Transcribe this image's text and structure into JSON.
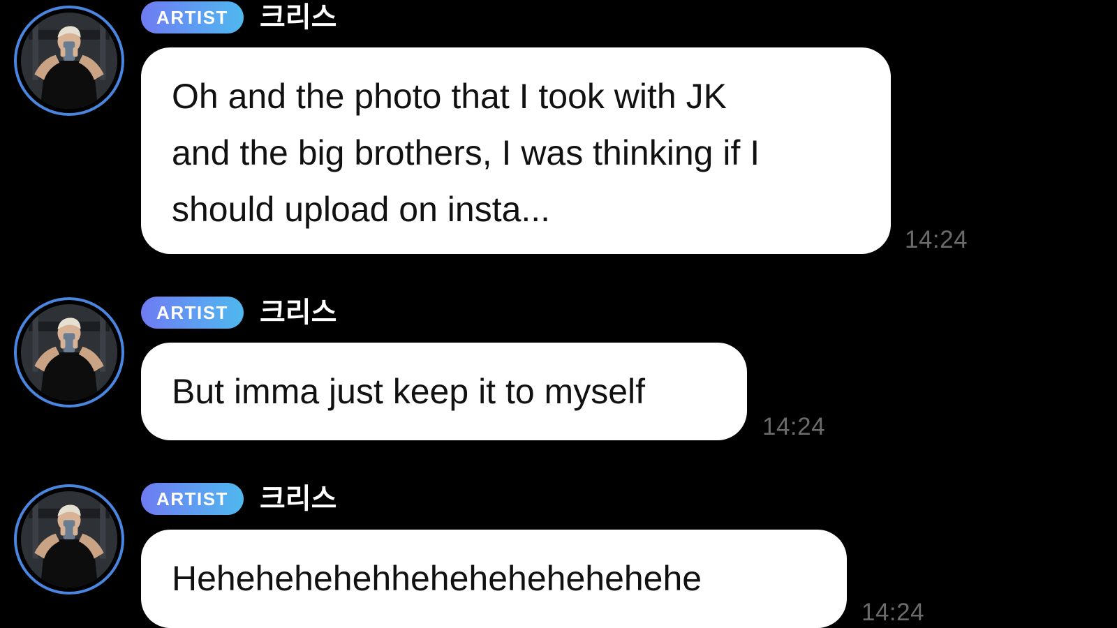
{
  "messages": [
    {
      "badge": "ARTIST",
      "sender": "크리스",
      "text": "Oh and the photo that I took with JK\nand the big brothers, I was thinking if I\nshould upload on insta...",
      "time": "14:24"
    },
    {
      "badge": "ARTIST",
      "sender": "크리스",
      "text": "But imma just keep it to myself",
      "time": "14:24"
    },
    {
      "badge": "ARTIST",
      "sender": "크리스",
      "text": "Hehehehehehhehehehehehehehe",
      "time": "14:24"
    }
  ],
  "colors": {
    "background": "#000000",
    "avatar_ring": "#4a86e0",
    "badge_gradient_start": "#6f7bf2",
    "badge_gradient_end": "#4fb8ee",
    "bubble": "#ffffff",
    "timestamp": "#6b6b6b"
  }
}
